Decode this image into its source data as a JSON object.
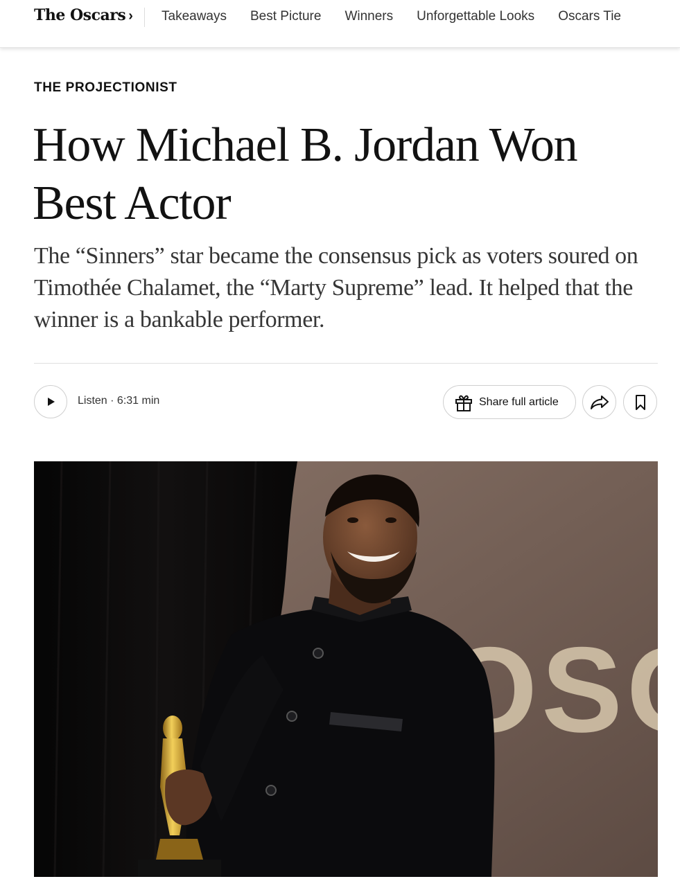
{
  "nav": {
    "section_title": "The Oscars",
    "section_chevron": "›",
    "links": [
      "Takeaways",
      "Best Picture",
      "Winners",
      "Unforgettable Looks",
      "Oscars Tie"
    ]
  },
  "article": {
    "kicker": "THE PROJECTIONIST",
    "headline": "How Michael B. Jordan Won Best Actor",
    "summary": "The “Sinners” star became the consensus pick as voters soured on Timothée Chalamet, the “Marty Supreme” lead. It helped that the winner is a bankable performer."
  },
  "toolbar": {
    "listen_label": "Listen · 6:31 min",
    "share_full_label": "Share full article"
  },
  "hero": {
    "backdrop_text": "OSCA"
  },
  "icons": {
    "play": "play-icon",
    "gift": "gift-icon",
    "share": "share-arrow-icon",
    "save": "bookmark-icon"
  }
}
